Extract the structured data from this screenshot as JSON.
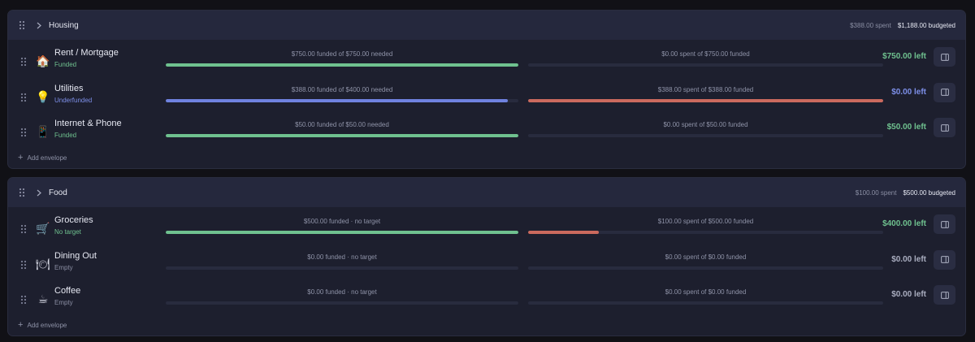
{
  "colors": {
    "funded_bar": "#6fc18f",
    "underfunded_bar": "#6f82e0",
    "spent_bar": "#cb6a5e",
    "funded_status": "#6fc18f",
    "underfunded_status": "#7d8fe8",
    "neutral_status": "#8a8ea3",
    "left_green": "#6fc18f",
    "left_blue": "#7d8fe8",
    "left_neutral": "#a9adbf"
  },
  "groups": [
    {
      "name": "Housing",
      "spent": "$388.00 spent",
      "budgeted": "$1,188.00 budgeted",
      "add_label": "Add envelope",
      "envelopes": [
        {
          "icon": "🏠",
          "icon_name": "house-icon",
          "name": "Rent / Mortgage",
          "status": "Funded",
          "status_kind": "funded",
          "funded_label": "$750.00 funded of $750.00 needed",
          "funded_fraction": 1.0,
          "funded_kind": "funded",
          "spent_label": "$0.00 spent of $750.00 funded",
          "spent_fraction": 0.0,
          "left": "$750.00 left",
          "left_kind": "green"
        },
        {
          "icon": "💡",
          "icon_name": "lightbulb-icon",
          "name": "Utilities",
          "status": "Underfunded",
          "status_kind": "underfunded",
          "funded_label": "$388.00 funded of $400.00 needed",
          "funded_fraction": 0.97,
          "funded_kind": "underfunded",
          "spent_label": "$388.00 spent of $388.00 funded",
          "spent_fraction": 1.0,
          "left": "$0.00 left",
          "left_kind": "blue"
        },
        {
          "icon": "📱",
          "icon_name": "phone-icon",
          "name": "Internet & Phone",
          "status": "Funded",
          "status_kind": "funded",
          "funded_label": "$50.00 funded of $50.00 needed",
          "funded_fraction": 1.0,
          "funded_kind": "funded",
          "spent_label": "$0.00 spent of $50.00 funded",
          "spent_fraction": 0.0,
          "left": "$50.00 left",
          "left_kind": "green"
        }
      ]
    },
    {
      "name": "Food",
      "spent": "$100.00 spent",
      "budgeted": "$500.00 budgeted",
      "add_label": "Add envelope",
      "envelopes": [
        {
          "icon": "🛒",
          "icon_name": "shopping-cart-icon",
          "name": "Groceries",
          "status": "No target",
          "status_kind": "funded",
          "funded_label": "$500.00 funded · no target",
          "funded_fraction": 1.0,
          "funded_kind": "funded",
          "spent_label": "$100.00 spent of $500.00 funded",
          "spent_fraction": 0.2,
          "left": "$400.00 left",
          "left_kind": "green"
        },
        {
          "icon": "🍽",
          "icon_name": "plate-icon",
          "name": "Dining Out",
          "status": "Empty",
          "status_kind": "neutral",
          "funded_label": "$0.00 funded · no target",
          "funded_fraction": 0.0,
          "funded_kind": "funded",
          "spent_label": "$0.00 spent of $0.00 funded",
          "spent_fraction": 0.0,
          "left": "$0.00 left",
          "left_kind": "neutral"
        },
        {
          "icon": "☕",
          "icon_name": "coffee-icon",
          "name": "Coffee",
          "status": "Empty",
          "status_kind": "neutral",
          "funded_label": "$0.00 funded · no target",
          "funded_fraction": 0.0,
          "funded_kind": "funded",
          "spent_label": "$0.00 spent of $0.00 funded",
          "spent_fraction": 0.0,
          "left": "$0.00 left",
          "left_kind": "neutral"
        }
      ]
    }
  ]
}
